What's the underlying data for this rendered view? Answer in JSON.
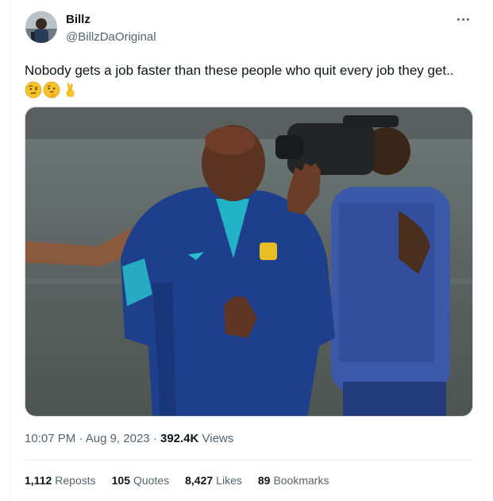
{
  "tweet": {
    "author_name": "Billz",
    "author_handle": "@BillzDaOriginal",
    "text": "Nobody gets a job faster than these people who quit every job they get..",
    "emojis": [
      "face-with-raised-eyebrow",
      "thinking-face",
      "crossed-fingers"
    ],
    "time": "10:07 PM",
    "date": "Aug 9, 2023",
    "views_count": "392.4K",
    "views_label": "Views",
    "separator": "·"
  },
  "stats": [
    {
      "count": "1,112",
      "label": "Reposts"
    },
    {
      "count": "105",
      "label": "Quotes"
    },
    {
      "count": "8,427",
      "label": "Likes"
    },
    {
      "count": "89",
      "label": "Bookmarks"
    }
  ],
  "colors": {
    "text_primary": "#0f1419",
    "text_secondary": "#536471",
    "border": "#eff3f4"
  }
}
